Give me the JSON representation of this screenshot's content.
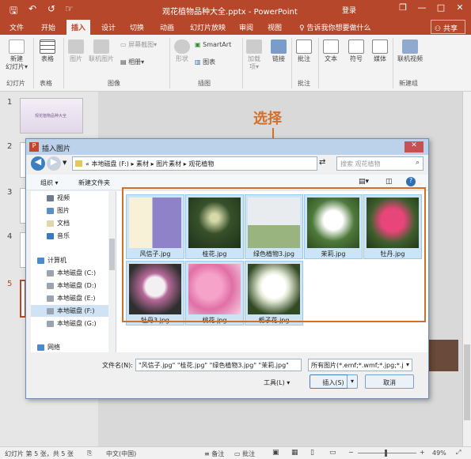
{
  "app": {
    "title": "观花植物品种大全.pptx - PowerPoint",
    "login": "登录",
    "share": "共享"
  },
  "qat": {
    "save": "🖫",
    "undo": "↶",
    "redo": "↺",
    "touch": "☞"
  },
  "window": {
    "restore": "❐",
    "minimize": "—",
    "maximize": "□",
    "close": "✕"
  },
  "tabs": [
    "文件",
    "开始",
    "插入",
    "设计",
    "切换",
    "动画",
    "幻灯片放映",
    "审阅",
    "视图"
  ],
  "tellme": "告诉我你想要做什么",
  "ribbon": {
    "new_slide": "新建\n幻灯片▾",
    "table": "表格",
    "picture": "图片",
    "online_picture": "联机图片",
    "screenshot": "屏幕截图▾",
    "album": "相册▾",
    "shapes": "形状",
    "smartart": "SmartArt",
    "chart": "图表",
    "addins": "加载\n项▾",
    "link": "链接",
    "comment": "批注",
    "text": "文本",
    "symbol": "符号",
    "media": "媒体",
    "online_video": "联机视频",
    "groups": {
      "slides": "幻灯片",
      "tables": "表格",
      "images": "图像",
      "illustrations": "插图",
      "comments": "批注",
      "newgroup": "新建组"
    }
  },
  "slides": {
    "numbers": [
      "1",
      "2",
      "3",
      "4",
      "5"
    ],
    "thumb1_text": "观花植物品种大全"
  },
  "callout": "选择",
  "dialog": {
    "title": "插入图片",
    "address": [
      "«",
      "本地磁盘 (F:)",
      "▸",
      "素材",
      "▸",
      "图片素材",
      "▸",
      "观花植物"
    ],
    "search_placeholder": "搜索 观花植物",
    "organize": "组织 ▾",
    "new_folder": "新建文件夹",
    "nav": [
      "视频",
      "图片",
      "文档",
      "音乐",
      "计算机",
      "本地磁盘 (C:)",
      "本地磁盘 (D:)",
      "本地磁盘 (E:)",
      "本地磁盘 (F:)",
      "本地磁盘 (G:)",
      "网络"
    ],
    "files": [
      "风信子.jpg",
      "桂花.jpg",
      "绿色植物3.jpg",
      "茉莉.jpg",
      "牡丹.jpg",
      "牡丹3.jpg",
      "桃花.jpg",
      "栀子花.jpg"
    ],
    "filename_label": "文件名(N):",
    "filename_value": "\"风信子.jpg\" \"桂花.jpg\" \"绿色植物3.jpg\" \"茉莉.jpg\"",
    "filetype_value": "所有图片(*.emf;*.wmf;*.jpg;*.j",
    "tools": "工具(L)",
    "insert": "插入(S)",
    "cancel": "取消"
  },
  "status": {
    "slide": "幻灯片 第 5 张，共 5 张",
    "lang": "中文(中国)",
    "notes": "备注",
    "comments": "批注",
    "zoom": "49%"
  },
  "colors": {
    "accent": "#b7472a",
    "callout": "#d2702a"
  }
}
